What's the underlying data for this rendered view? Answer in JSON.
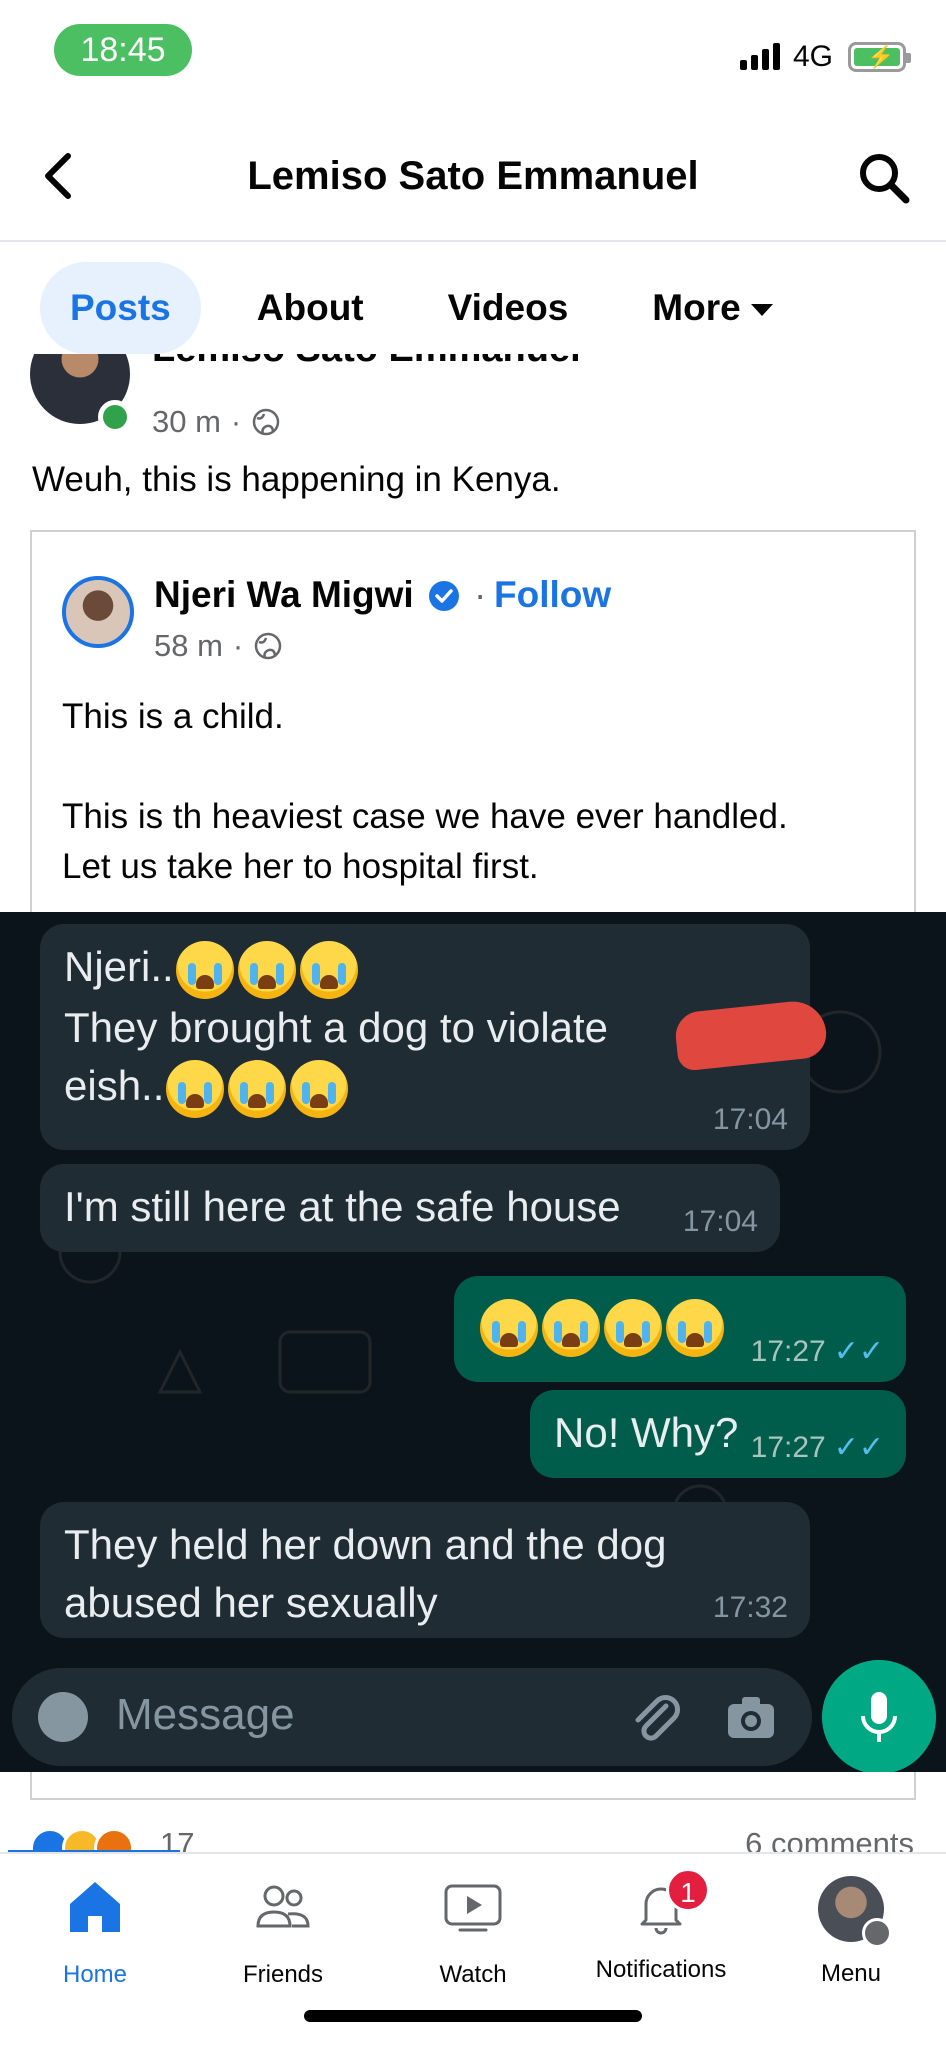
{
  "status_bar": {
    "time": "18:45",
    "network": "4G"
  },
  "header": {
    "title": "Lemiso Sato Emmanuel"
  },
  "tabs": [
    {
      "label": "Posts"
    },
    {
      "label": "About"
    },
    {
      "label": "Videos"
    },
    {
      "label": "More"
    }
  ],
  "post": {
    "author": "Lemiso Sato Emmanuel",
    "time": "30 m",
    "text": "Weuh, this is happening in Kenya.",
    "shared": {
      "author": "Njeri Wa Migwi",
      "follow_label": "Follow",
      "time": "58 m",
      "text_line1": "This is a child.",
      "text_line2": "This is th heaviest case we have ever handled.",
      "text_line3": "Let us take her to hospital first."
    },
    "reactions_count": "17",
    "comments_count": "6 comments"
  },
  "chat": {
    "messages": [
      {
        "lines": [
          "Njeri..",
          "They brought a dog to violate",
          "eish.."
        ],
        "time": "17:04"
      },
      {
        "text": "I'm still here at the safe house",
        "time": "17:04"
      },
      {
        "text": "",
        "time": "17:27"
      },
      {
        "text": "No! Why?",
        "time": "17:27"
      },
      {
        "lines": [
          "They held her down and the dog",
          "abused her sexually"
        ],
        "time": "17:32"
      }
    ],
    "input_placeholder": "Message"
  },
  "bottom_nav": {
    "items": [
      {
        "label": "Home"
      },
      {
        "label": "Friends"
      },
      {
        "label": "Watch"
      },
      {
        "label": "Notifications",
        "badge": "1"
      },
      {
        "label": "Menu"
      }
    ]
  },
  "colors": {
    "accent": "#1b74e4",
    "chat_bg": "#0b141a",
    "bubble_in": "#202c33",
    "bubble_out": "#005c4b",
    "badge": "#e41e3f"
  },
  "icons": [
    "back-arrow-icon",
    "search-icon",
    "globe-icon",
    "verified-icon",
    "emoji-icon",
    "attach-icon",
    "camera-icon",
    "mic-icon",
    "home-icon",
    "friends-icon",
    "watch-icon",
    "bell-icon"
  ]
}
